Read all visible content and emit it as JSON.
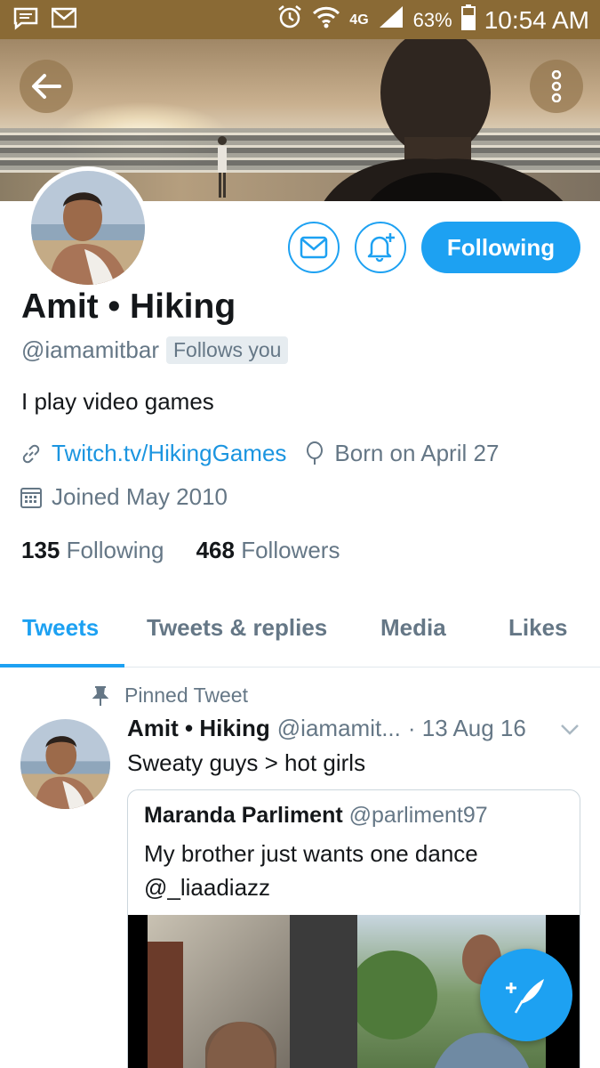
{
  "status_bar": {
    "network": "4G",
    "battery_percent": "63%",
    "time": "10:54 AM",
    "icons": [
      "message-icon",
      "gmail-icon",
      "alarm-icon",
      "wifi-icon",
      "signal-icon",
      "battery-icon"
    ]
  },
  "header": {
    "back_icon": "arrow-left-icon",
    "more_icon": "more-vertical-icon"
  },
  "profile": {
    "name": "Amit • Hiking",
    "handle": "@iamamitbar",
    "follows_you": "Follows you",
    "bio": "I play video games",
    "website": "Twitch.tv/HikingGames",
    "birthday": "Born on April 27",
    "joined": "Joined May 2010",
    "following_count": "135",
    "following_label": "Following",
    "followers_count": "468",
    "followers_label": "Followers"
  },
  "actions": {
    "following_button": "Following",
    "message_icon": "envelope-icon",
    "notify_icon": "bell-plus-icon"
  },
  "tabs": [
    {
      "label": "Tweets",
      "active": true
    },
    {
      "label": "Tweets & replies",
      "active": false
    },
    {
      "label": "Media",
      "active": false
    },
    {
      "label": "Likes",
      "active": false
    }
  ],
  "tweet": {
    "pinned_label": "Pinned Tweet",
    "author_name": "Amit • Hiking",
    "author_handle": "@iamamit...",
    "date": "· 13 Aug 16",
    "text": "Sweaty guys > hot girls",
    "quote": {
      "author_name": "Maranda Parliment",
      "author_handle": "@parliment97",
      "text_line1": "My brother just wants one dance",
      "text_line2": "@_liaadiazz"
    }
  },
  "colors": {
    "accent": "#1da1f2",
    "link": "#1b95e0",
    "secondary_text": "#657786",
    "status_bar": "#8a6a35"
  }
}
